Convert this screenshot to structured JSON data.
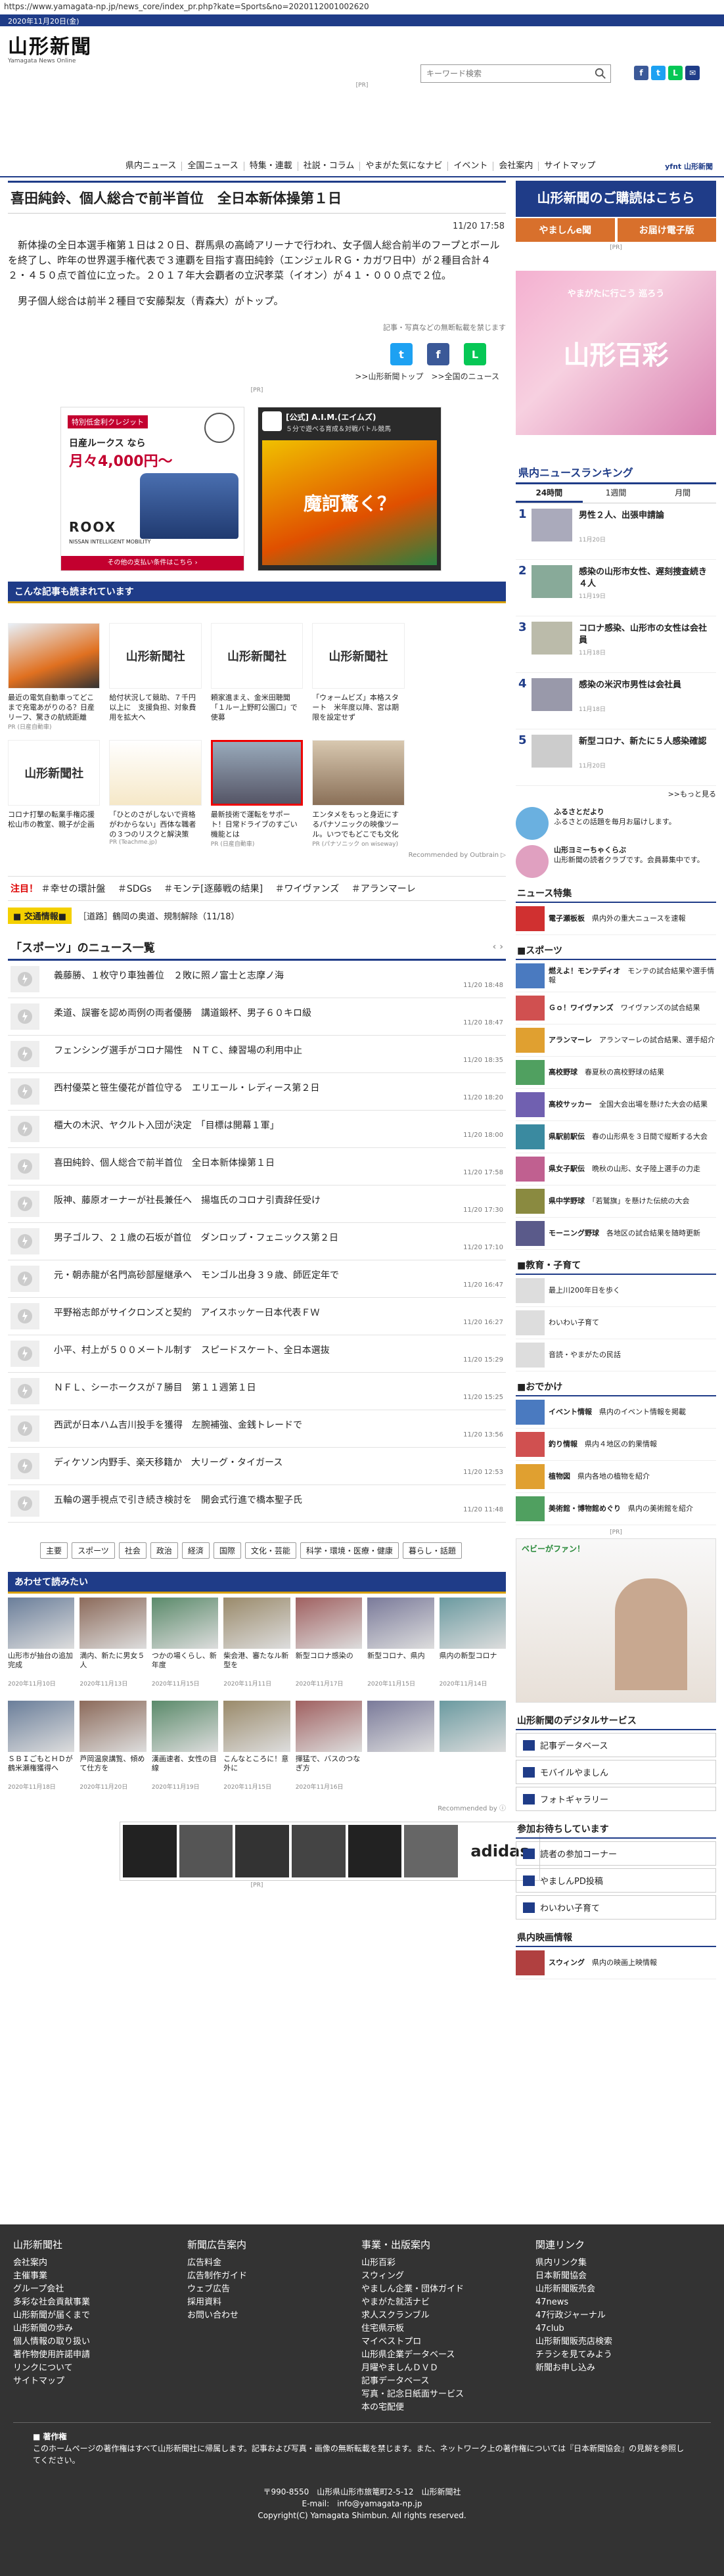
{
  "browser": {
    "url": "https://www.yamagata-np.jp/news_core/index_pr.php?kate=Sports&no=2020112001002620"
  },
  "header": {
    "date": "2020年11月20日(金)",
    "logo": "山形新聞",
    "logo_sub": "Yamagata News Online",
    "search_placeholder": "キーワード検索",
    "social": [
      "f",
      "t",
      "L",
      "✉"
    ],
    "pr": "[PR]"
  },
  "nav": {
    "items": [
      "県内ニュース",
      "全国ニュース",
      "特集・連載",
      "社説・コラム",
      "やまがた気になナビ",
      "イベント",
      "会社案内",
      "サイトマップ"
    ],
    "top_label": "yfnt 山形新聞"
  },
  "article": {
    "title": "喜田純鈴、個人総合で前半首位　全日本新体操第１日",
    "datetime": "11/20 17:58",
    "paragraphs": [
      "新体操の全日本選手権第１日は２０日、群馬県の高崎アリーナで行われ、女子個人総合前半のフープとボールを終了し、昨年の世界選手権代表で３連覇を目指す喜田純鈴（エンジェルＲＧ・カガワ日中）が２種目合計４２・４５０点で首位に立った。２０１７年大会覇者の立沢孝菜（イオン）が４１・０００点で２位。",
      "男子個人総合は前半２種目で安藤梨友（青森大）がトップ。"
    ],
    "note": "記事・写真などの無断転載を禁じます",
    "share": [
      "t",
      "f",
      "L"
    ],
    "breadcrumb": ">>山形新聞トップ　>>全国のニュース"
  },
  "ads": {
    "pr": "[PR]",
    "nissan": {
      "top": "特別低金利クレジット",
      "model": "日産ルークス なら",
      "price": "月々4,000円〜",
      "name": "ROOX",
      "tag": "NISSAN INTELLIGENT MOBILITY",
      "note": "その他の支払い条件はこちら ›"
    },
    "aim": {
      "brand": "[公式] A.I.M.(エイムズ)",
      "sub": "５分で遊べる育成＆対戦バトル競馬",
      "banner": "魔訶驚く？"
    }
  },
  "outbrain": {
    "title": "こんな記事も読まれています",
    "cards": [
      {
        "thumb": "",
        "caption": "最近の電気自動車ってどこまで充電あがりのる？日産リーフ、驚きの航続距離",
        "src": "PR (日産自動車)"
      },
      {
        "thumb": "山形新聞社",
        "caption": "給付状況して競助、７千円以上に　支援負担、対象費用を拡大へ",
        "src": ""
      },
      {
        "thumb": "山形新聞社",
        "caption": "頼家進まえ、金米田聴聞「１ルー上野町公園口」で使募",
        "src": ""
      },
      {
        "thumb": "山形新聞社",
        "caption": "「ウォームビズ」本格スタート　米年度以降、宮は期限を設定せず",
        "src": ""
      },
      {
        "thumb": "",
        "caption": "",
        "src": ""
      },
      {
        "thumb": "山形新聞社",
        "caption": "コロナ打撃の転業手権応援　松山市の教室、親子が企画",
        "src": ""
      },
      {
        "thumb": "",
        "caption": "「ひとのさがしないで資格がわからない」西体な職者の３つのリスクと解決策",
        "src": "PR (Teachme.jp)"
      },
      {
        "thumb": "",
        "caption": "最新技術で運転をサポート！日常ドライブのすごい機能とは",
        "src": "PR (日産自動車)"
      },
      {
        "thumb": "",
        "caption": "エンタメをもっと身近にするパナソニックの映像ツール。いつでもどこでも文化を目の前へ",
        "src": "PR (パナソニック on wiseway)"
      },
      {
        "thumb": "",
        "caption": "",
        "src": ""
      }
    ],
    "recommended": "Recommended by Outbrain ▷"
  },
  "tags": {
    "label": "注目！",
    "items": [
      "＃幸せの環計盤",
      "＃SDGs",
      "＃モンテ[逐藤戦の結果]",
      "＃ワイヴァンズ",
      "＃アランマーレ"
    ]
  },
  "traffic": {
    "label": "■ 交通情報■",
    "text": "［道路］鶴岡の奥道、規制解除（11/18）"
  },
  "sports_list": {
    "title": "「スポーツ」のニュース一覧",
    "nav": "‹ ›",
    "items": [
      {
        "title": "義藤勝、１枚守り車独善位　２敗に照ノ富士と志摩ノ海",
        "date": "11/20 18:48"
      },
      {
        "title": "柔道、誤審を認め両例の両者優勝　講道鍛杯、男子６０キロ級",
        "date": "11/20 18:47"
      },
      {
        "title": "フェンシング選手がコロナ陽性　ＮＴＣ、練習場の利用中止",
        "date": "11/20 18:35"
      },
      {
        "title": "西村優菜と笹生優花が首位守る　エリエール・レディース第２日",
        "date": "11/20 18:20"
      },
      {
        "title": "櫃大の木沢、ヤクルト入団が決定　「目標は開幕１軍」",
        "date": "11/20 18:00"
      },
      {
        "title": "喜田純鈴、個人総合で前半首位　全日本新体操第１日",
        "date": "11/20 17:58"
      },
      {
        "title": "阪神、藤原オーナーが社長兼任へ　揚塩氏のコロナ引責辞任受け",
        "date": "11/20 17:30"
      },
      {
        "title": "男子ゴルフ、２１歳の石坂が首位　ダンロップ・フェニックス第２日",
        "date": "11/20 17:10"
      },
      {
        "title": "元・朝赤龍が名門高砂部屋継承へ　モンゴル出身３９歳、師匠定年で",
        "date": "11/20 16:47"
      },
      {
        "title": "平野裕志郎がサイクロンズと契約　アイスホッケー日本代表ＦＷ",
        "date": "11/20 16:27"
      },
      {
        "title": "小平、村上が５００メートル制す　スピードスケート、全日本選抜",
        "date": "11/20 15:29"
      },
      {
        "title": "ＮＦＬ、シーホークスが７勝目　第１１週第１日",
        "date": "11/20 15:25"
      },
      {
        "title": "西武が日本ハム吉川投手を獲得　左腕補強、金銭トレードで",
        "date": "11/20 13:56"
      },
      {
        "title": "ディケソン内野手、楽天移籍か　大リーグ・タイガース",
        "date": "11/20 12:53"
      },
      {
        "title": "五輪の選手視点で引き続き検討を　開会式行進で橋本聖子氏",
        "date": "11/20 11:48"
      }
    ]
  },
  "categories": [
    "主要",
    "スポーツ",
    "社会",
    "政治",
    "経済",
    "国際",
    "文化・芸能",
    "科学・環境・医療・健康",
    "暮らし・話題"
  ],
  "awase": {
    "title": "あわせて読みたい",
    "items": [
      {
        "caption": "山形市が抽台の追加完成",
        "date": "2020年11月10日"
      },
      {
        "caption": "満内、新たに男女５人",
        "date": "2020年11月13日"
      },
      {
        "caption": "つかの場くらし、新年度",
        "date": "2020年11月15日"
      },
      {
        "caption": "柴会港、審たなル新型を",
        "date": "2020年11月11日"
      },
      {
        "caption": "新型コロナ感染の",
        "date": "2020年11月17日"
      },
      {
        "caption": "新型コロナ、県内",
        "date": "2020年11月15日"
      },
      {
        "caption": "県内の新型コロナ",
        "date": "2020年11月14日"
      },
      {
        "caption": "ＳＢＩごもとＨＤが鶴米瀬権獲得へ",
        "date": "2020年11月18日"
      },
      {
        "caption": "芦岡温泉講覧、傾めて仕方を",
        "date": "2020年11月20日"
      },
      {
        "caption": "漢画速者、女性の目線",
        "date": "2020年11月19日"
      },
      {
        "caption": "こんなところに！意外に",
        "date": "2020年11月15日"
      },
      {
        "caption": "揮猛で、バスのつなぎ方",
        "date": "2020年11月16日"
      },
      {
        "caption": "",
        "date": ""
      },
      {
        "caption": "",
        "date": ""
      }
    ],
    "recommended": "Recommended by ⓘ"
  },
  "adidas": {
    "brand": "adidas"
  },
  "right": {
    "subscribe": "山形新聞のご購読はこちら",
    "btn1": "やましんe聞",
    "btn2": "お届け電子版",
    "hyakusai": "山形百彩",
    "hyakusai_sub": "やまがたに行こう 巡ろう",
    "ranking": {
      "title": "県内ニュースランキング",
      "tabs": [
        "24時間",
        "1週間",
        "月間"
      ],
      "items": [
        {
          "rank": "1",
          "title": "男性２人、出張申請論",
          "date": "11月20日"
        },
        {
          "rank": "2",
          "title": "感染の山形市女性、遅刻捜査続き４人",
          "date": "11月19日"
        },
        {
          "rank": "3",
          "title": "コロナ感染、山形市の女性は会社員",
          "date": "11月18日"
        },
        {
          "rank": "4",
          "title": "感染の米沢市男性は会社員",
          "date": "11月18日"
        },
        {
          "rank": "5",
          "title": "新型コロナ、新たに５人感染確認",
          "date": "11月20日"
        }
      ],
      "more": ">>もっと見る"
    },
    "furusato": [
      {
        "title": "ふるさとだより",
        "text": "ふるさとの話題を毎月お届けします。"
      },
      {
        "title": "山形ヨミーちゃくらぶ",
        "text": "山形新聞の読者クラブです。会員募集中です。"
      }
    ],
    "tokushu": {
      "title": "ニュース特集",
      "items": [
        {
          "title": "電子瀬板板",
          "text": "県内外の重大ニュースを速報"
        }
      ]
    },
    "sports": {
      "title": "■スポーツ",
      "items": [
        {
          "title": "燃えよ！モンテディオ",
          "text": "モンテの試合結果や選手情報"
        },
        {
          "title": "Ｇｏ！ワイヴァンズ",
          "text": "ワイヴァンズの試合結果"
        },
        {
          "title": "アランマーレ",
          "text": "アランマーレの試合結果、選手紹介"
        },
        {
          "title": "高校野球",
          "text": "春夏秋の高校野球の結果"
        },
        {
          "title": "高校サッカー",
          "text": "全国大会出場を懸けた大会の結果"
        },
        {
          "title": "県駅前駅伝",
          "text": "春の山形県を３日間で縦断する大会"
        },
        {
          "title": "県女子駅伝",
          "text": "晩秋の山形、女子陸上選手の力走"
        },
        {
          "title": "県中学野球",
          "text": "「若鷲旗」を懸けた伝統の大会"
        },
        {
          "title": "モーニング野球",
          "text": "各地区の試合結果を随時更新"
        }
      ]
    },
    "kyoiku": {
      "title": "■教育・子育て",
      "items": [
        "最上川200年日を歩く",
        "わいわい子育て",
        "音読・やまがたの民話"
      ]
    },
    "dekake": {
      "title": "■おでかけ",
      "items": [
        {
          "title": "イベント情報",
          "text": "県内のイベント情報を掲載"
        },
        {
          "title": "釣り情報",
          "text": "県内４地区の釣果情報"
        },
        {
          "title": "植物図",
          "text": "県内各地の植物を紹介"
        },
        {
          "title": "美術館・博物館めぐり",
          "text": "県内の美術館を紹介"
        }
      ]
    },
    "babyfan": "ベビーがファン！",
    "digital": {
      "title": "山形新聞のデジタルサービス",
      "items": [
        "記事データベース",
        "モバイルやましん",
        "フォトギャラリー"
      ]
    },
    "sanka": {
      "title": "参加お待ちしています",
      "items": [
        "読者の参加コーナー",
        "やましんPD投稿",
        "わいわい子育て"
      ]
    },
    "eiga": {
      "title": "県内映画情報",
      "item": "スウィング",
      "text": "県内の映画上映情報"
    }
  },
  "footer": {
    "cols": [
      {
        "title": "山形新聞社",
        "links": [
          "会社案内",
          "主催事業",
          "グループ会社",
          "多彩な社会貢献事業",
          "山形新聞が届くまで",
          "山形新聞の歩み",
          "個人情報の取り扱い",
          "著作物使用許諾申請",
          "リンクについて",
          "サイトマップ"
        ]
      },
      {
        "title": "新聞広告案内",
        "links": [
          "広告料金",
          "広告制作ガイド",
          "ウェブ広告",
          "採用資料",
          "お問い合わせ"
        ]
      },
      {
        "title": "事業・出版案内",
        "links": [
          "山形百彩",
          "スウィング",
          "やましん企業・団体ガイド",
          "やまがた就活ナビ",
          "求人スクランブル",
          "住宅県示板",
          "マイベストプロ",
          "山形県企業データベース",
          "月曜やましんＤＶＤ",
          "記事データベース",
          "写真・記念日紙面サービス",
          "本の宅配便"
        ]
      },
      {
        "title": "関連リンク",
        "links": [
          "県内リンク集",
          "日本新聞協会",
          "山形新聞販売会",
          "47news",
          "47行政ジャーナル",
          "47club",
          "山形新聞販売店検索",
          "チラシを見てみよう",
          "新聞お申し込み"
        ]
      }
    ],
    "copyright_title": "■ 著作権",
    "copyright_text": "このホームページの著作権はすべて山形新聞社に帰属します。記事および写真・画像の無断転載を禁じます。また、ネットワーク上の著作権については『日本新聞協会』の見解を参照してください。",
    "address": "〒990-8550　山形県山形市旅篭町2-5-12　山形新聞社",
    "email": "E-mail:　info@yamagata-np.jp",
    "copyright": "Copyright(C) Yamagata Shimbun. All rights reserved."
  }
}
